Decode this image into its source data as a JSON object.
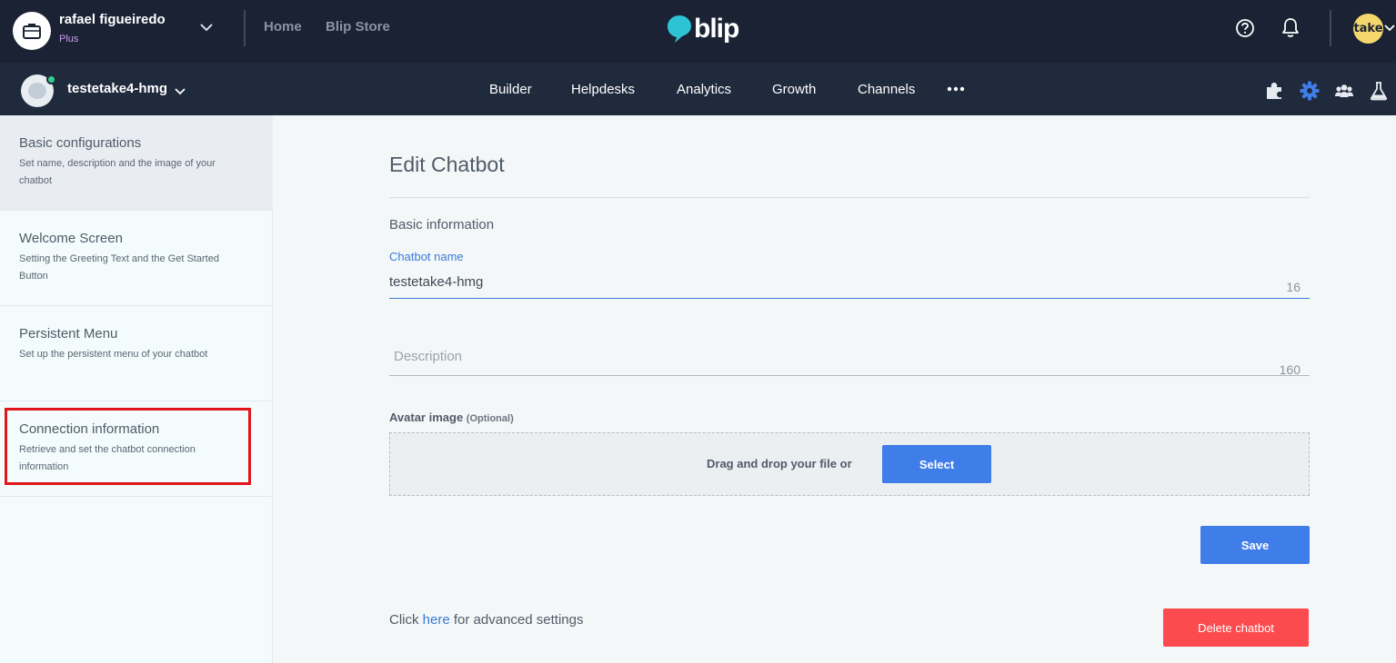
{
  "topbar": {
    "org_name": "rafael figueiredo",
    "org_plan": "Plus",
    "links": [
      "Home",
      "Blip Store"
    ],
    "logo_text": "blip",
    "logo_color": "#2cc3d5",
    "user_avatar_text": "take",
    "icons": [
      "briefcase-icon",
      "chevron-down-icon",
      "help-icon",
      "bell-icon"
    ]
  },
  "navbar": {
    "bot_name": "testetake4-hmg",
    "items": [
      "Builder",
      "Helpdesks",
      "Analytics",
      "Growth",
      "Channels"
    ],
    "tools": [
      "puzzle-icon",
      "gear-icon",
      "users-icon",
      "flask-icon"
    ],
    "active_tool_color": "#3f7de8"
  },
  "sidebar": {
    "items": [
      {
        "title": "Basic configurations",
        "desc": "Set name, description and the image of your chatbot",
        "active": true
      },
      {
        "title": "Welcome Screen",
        "desc": "Setting the Greeting Text and the Get Started Button",
        "active": false
      },
      {
        "title": "Persistent Menu",
        "desc": "Set up the persistent menu of your chatbot",
        "active": false
      },
      {
        "title": "Connection information",
        "desc": "Retrieve and set the chatbot connection information",
        "active": false,
        "highlighted": true
      }
    ]
  },
  "main": {
    "title": "Edit Chatbot",
    "section_title": "Basic information",
    "name_field": {
      "label": "Chatbot name",
      "value": "testetake4-hmg",
      "counter": "16"
    },
    "description_field": {
      "placeholder": "Description",
      "counter": "160"
    },
    "avatar": {
      "label": "Avatar image",
      "optional": "(Optional)",
      "drop_text": "Drag and drop your file or",
      "select_label": "Select"
    },
    "save_label": "Save",
    "advanced": {
      "prefix": "Click",
      "link": "here",
      "suffix": "for advanced settings"
    },
    "delete_label": "Delete chatbot"
  }
}
